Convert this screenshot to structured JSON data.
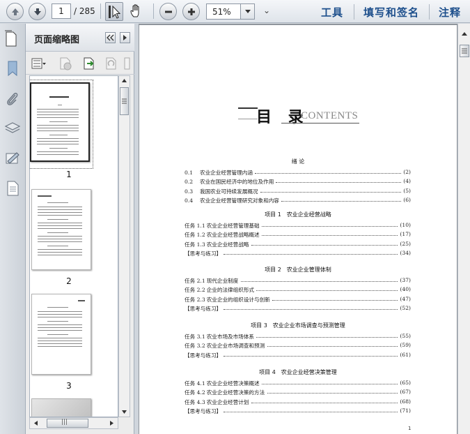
{
  "toolbar": {
    "page_current": "1",
    "page_total": "/ 285",
    "zoom": "51%",
    "tools_label": "工具",
    "sign_label": "填写和签名",
    "comment_label": "注释",
    "more_glyph": "⌄"
  },
  "panel": {
    "title": "页面缩略图",
    "thumbnails": [
      {
        "label": "1"
      },
      {
        "label": "2"
      },
      {
        "label": "3"
      }
    ],
    "hscroll_grip": "|||"
  },
  "document": {
    "title_cn": "目 录",
    "title_en": "CONTENTS",
    "page_number": "1",
    "sections": [
      {
        "heading": "绪 论",
        "items": [
          {
            "num": "0.1",
            "name": "农业企业经营管理内涵",
            "page": "(2)"
          },
          {
            "num": "0.2",
            "name": "农业在国民经济中的地位及作用",
            "page": "(4)"
          },
          {
            "num": "0.3",
            "name": "我国农业可持续发展概况",
            "page": "(5)"
          },
          {
            "num": "0.4",
            "name": "农业企业经营管理研究对象和内容",
            "page": "(6)"
          }
        ]
      },
      {
        "heading": "项目 1　农业企业经营战略",
        "items": [
          {
            "num": "任务 1.1",
            "name": "农业企业经营管理基础",
            "page": "(10)"
          },
          {
            "num": "任务 1.2",
            "name": "农业企业经营战略概述",
            "page": "(17)"
          },
          {
            "num": "任务 1.3",
            "name": "农业企业经营战略",
            "page": "(25)"
          },
          {
            "num": "【思考与练习】",
            "name": "",
            "page": "(34)"
          }
        ]
      },
      {
        "heading": "项目 2　农业企业管理体制",
        "items": [
          {
            "num": "任务 2.1",
            "name": "现代企业制度",
            "page": "(37)"
          },
          {
            "num": "任务 2.2",
            "name": "企业的法律组织形式",
            "page": "(40)"
          },
          {
            "num": "任务 2.3",
            "name": "农业企业的组织设计与创新",
            "page": "(47)"
          },
          {
            "num": "【思考与练习】",
            "name": "",
            "page": "(52)"
          }
        ]
      },
      {
        "heading": "项目 3　农业企业市场调查与预测管理",
        "items": [
          {
            "num": "任务 3.1",
            "name": "农业市场及市场体系",
            "page": "(55)"
          },
          {
            "num": "任务 3.2",
            "name": "农业企业市场调查和预测",
            "page": "(59)"
          },
          {
            "num": "【思考与练习】",
            "name": "",
            "page": "(61)"
          }
        ]
      },
      {
        "heading": "项目 4　农业企业经营决策管理",
        "items": [
          {
            "num": "任务 4.1",
            "name": "农业企业经营决策概述",
            "page": "(65)"
          },
          {
            "num": "任务 4.2",
            "name": "农业企业经营决策的方法",
            "page": "(67)"
          },
          {
            "num": "任务 4.3",
            "name": "农业企业经营计划",
            "page": "(68)"
          },
          {
            "num": "【思考与练习】",
            "name": "",
            "page": "(71)"
          }
        ]
      }
    ]
  },
  "colors": {
    "accent_link": "#1d4f8c",
    "toolbar_bg": "#e6eaef",
    "doc_bg": "#8f959c"
  },
  "icons": [
    "arrow-up-icon",
    "arrow-down-icon",
    "select-cursor-icon",
    "hand-icon",
    "zoom-out-icon",
    "zoom-in-icon",
    "pages-icon",
    "bookmark-icon",
    "attachment-icon",
    "layers-icon",
    "signature-icon",
    "document-icon",
    "options-icon",
    "delete-icon",
    "insert-page-icon",
    "rotate-icon"
  ]
}
